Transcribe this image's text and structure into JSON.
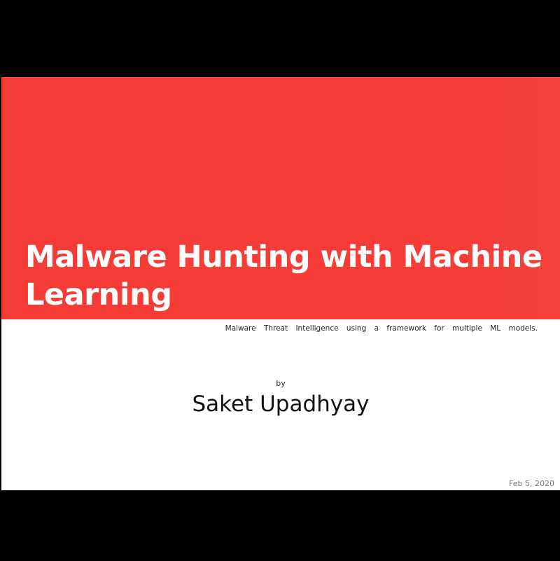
{
  "slide": {
    "title": "Malware Hunting with Machine Learning",
    "subtitle": "Malware Threat Intelligence using a framework for multiple ML models.",
    "by_label": "by",
    "author": "Saket Upadhyay",
    "date": "Feb 5, 2020"
  }
}
